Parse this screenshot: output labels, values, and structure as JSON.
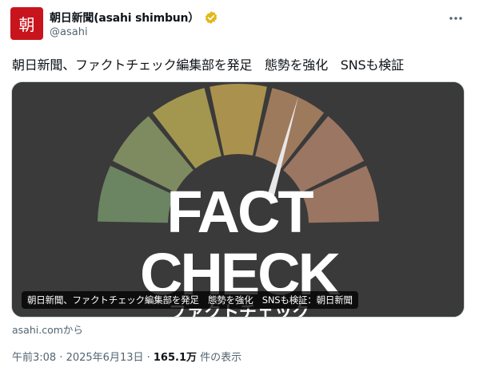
{
  "author": {
    "avatar_text": "朝",
    "name": "朝日新聞(asahi shimbun）",
    "handle": "@asahi",
    "verified": "verified-badge-gold"
  },
  "post": {
    "text": "朝日新聞、ファクトチェック編集部を発足　態勢を強化　SNSも検証"
  },
  "card": {
    "image_line1": "FACT",
    "image_line2": "CHECK",
    "image_subtitle": "ファクトチェック",
    "caption": "朝日新聞、ファクトチェック編集部を発足　態勢を強化　SNSも検証：朝日新聞",
    "gauge_colors": [
      "#6b8462",
      "#7e8a5f",
      "#a39750",
      "#ab914e",
      "#9e7a5c",
      "#9a7663",
      "#9a7562"
    ],
    "background": "#3a3a3a"
  },
  "source": "asahi.comから",
  "meta": {
    "time": "午前3:08 · 2025年6月13日 · ",
    "views_count": "165.1万",
    "views_label": " 件の表示"
  }
}
